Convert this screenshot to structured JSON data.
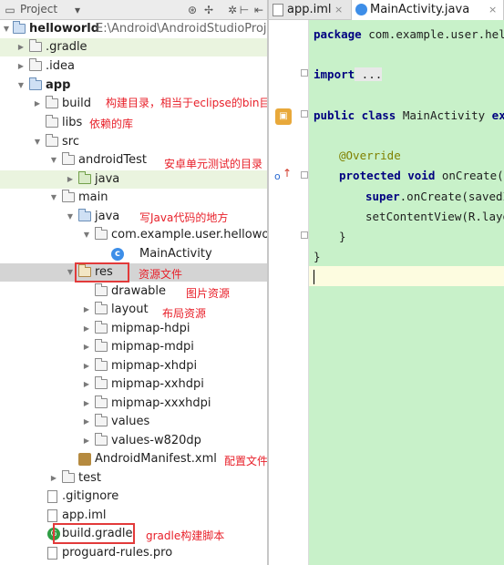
{
  "project_panel": {
    "title": "Project",
    "tree": [
      {
        "id": "helloworld",
        "label": "helloworld",
        "path": "E:\\Android\\AndroidStudioProje"
      },
      {
        "id": "gradle-dir",
        "label": ".gradle"
      },
      {
        "id": "idea-dir",
        "label": ".idea"
      },
      {
        "id": "app",
        "label": "app"
      },
      {
        "id": "build",
        "label": "build"
      },
      {
        "id": "libs",
        "label": "libs"
      },
      {
        "id": "src",
        "label": "src"
      },
      {
        "id": "androidTest",
        "label": "androidTest"
      },
      {
        "id": "androidTest-java",
        "label": "java"
      },
      {
        "id": "main",
        "label": "main"
      },
      {
        "id": "main-java",
        "label": "java"
      },
      {
        "id": "package",
        "label": "com.example.user.helloworld"
      },
      {
        "id": "MainActivity",
        "label": "MainActivity"
      },
      {
        "id": "res",
        "label": "res"
      },
      {
        "id": "drawable",
        "label": "drawable"
      },
      {
        "id": "layout",
        "label": "layout"
      },
      {
        "id": "mipmap-hdpi",
        "label": "mipmap-hdpi"
      },
      {
        "id": "mipmap-mdpi",
        "label": "mipmap-mdpi"
      },
      {
        "id": "mipmap-xhdpi",
        "label": "mipmap-xhdpi"
      },
      {
        "id": "mipmap-xxhdpi",
        "label": "mipmap-xxhdpi"
      },
      {
        "id": "mipmap-xxxhdpi",
        "label": "mipmap-xxxhdpi"
      },
      {
        "id": "values",
        "label": "values"
      },
      {
        "id": "values-w820dp",
        "label": "values-w820dp"
      },
      {
        "id": "AndroidManifest",
        "label": "AndroidManifest.xml"
      },
      {
        "id": "test",
        "label": "test"
      },
      {
        "id": "gitignore",
        "label": ".gitignore"
      },
      {
        "id": "app-iml",
        "label": "app.iml"
      },
      {
        "id": "build-gradle",
        "label": "build.gradle"
      },
      {
        "id": "proguard",
        "label": "proguard-rules.pro"
      }
    ]
  },
  "annotations": {
    "build": "构建目录，相当于eclipse的bin目录",
    "libs": "依赖的库",
    "androidTest": "安卓单元测试的目录",
    "main_java": "写Java代码的地方",
    "res": "资源文件",
    "drawable": "图片资源",
    "layout": "布局资源",
    "manifest": "配置文件",
    "build_gradle": "gradle构建脚本"
  },
  "editor": {
    "tabs": [
      {
        "label": "app.iml",
        "active": false
      },
      {
        "label": "MainActivity.java",
        "active": true
      }
    ],
    "code": {
      "package_kw": "package",
      "package_name": " com.example.user.hell",
      "import_kw": "import",
      "import_rest": " ...",
      "class_kw": "public class",
      "class_name": " MainActivity ",
      "class_ext": "ex",
      "override": "@Override",
      "method_kw": "protected void",
      "method_name": " onCreate(",
      "super_kw": "super",
      "super_call": ".onCreate(savedI",
      "setcontent": "setContentView(R.layou",
      "close_inner": "}",
      "close_outer": "}"
    }
  },
  "colors": {
    "annotation_red": "#e8202a",
    "code_bg": "#c8f1c9",
    "selection_gray": "#d4d4d4"
  }
}
